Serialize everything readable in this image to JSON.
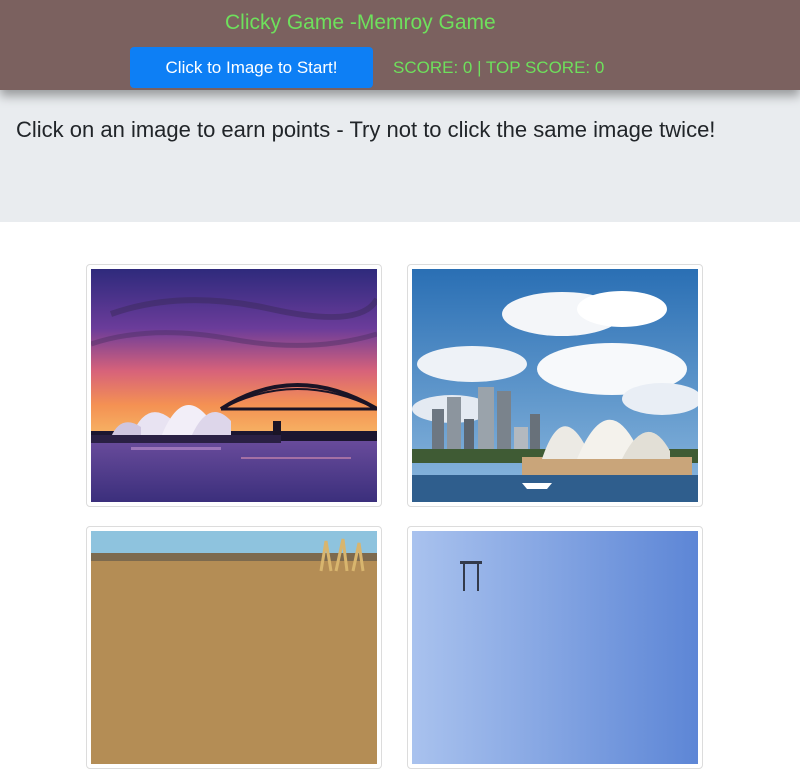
{
  "navbar": {
    "title": "Clicky Game -Memroy Game",
    "start_label": "Click to Image to Start!",
    "score_text": "SCORE: 0 | TOP SCORE: 0"
  },
  "jumbotron": {
    "instructions": "Click on an image to earn points - Try not to click the same image twice!"
  },
  "images": [
    {
      "subject": "sydney-opera-house-sunset"
    },
    {
      "subject": "sydney-opera-house-city-skyline"
    },
    {
      "subject": "outback-landscape"
    },
    {
      "subject": "blue-sky-tower"
    }
  ],
  "colors": {
    "navbar_bg": "#7b615f",
    "accent_green": "#6ee05c",
    "button_blue": "#0d7ff5",
    "jumbotron_bg": "#e9ecef"
  }
}
